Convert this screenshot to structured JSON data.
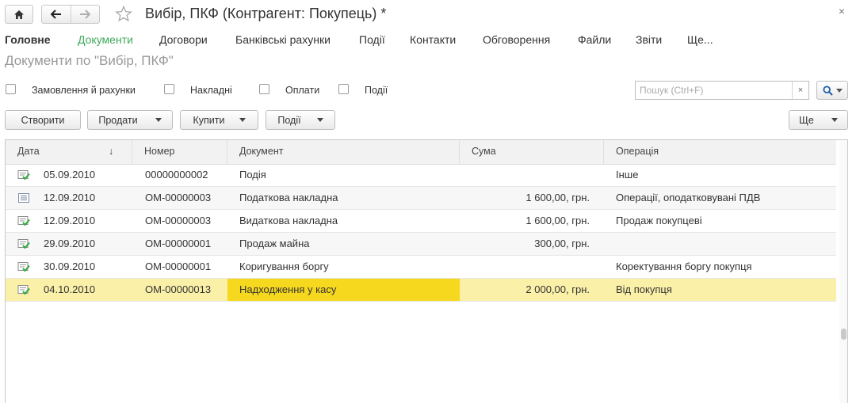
{
  "window": {
    "title": "Вибір, ПКФ (Контрагент: Покупець) *",
    "close_label": "×",
    "subtitle": "Документи по \"Вибір, ПКФ\""
  },
  "tabs": [
    {
      "label": "Головне",
      "state": "bold"
    },
    {
      "label": "Документи",
      "state": "active"
    },
    {
      "label": "Договори",
      "state": "normal"
    },
    {
      "label": "Банківські рахунки",
      "state": "normal"
    },
    {
      "label": "Події",
      "state": "normal"
    },
    {
      "label": "Контакти",
      "state": "normal"
    },
    {
      "label": "Обговорення",
      "state": "normal"
    },
    {
      "label": "Файли",
      "state": "normal"
    },
    {
      "label": "Звіти",
      "state": "normal"
    },
    {
      "label": "Ще...",
      "state": "normal"
    }
  ],
  "filters": [
    {
      "label": "Замовлення й рахунки",
      "checked": false
    },
    {
      "label": "Накладні",
      "checked": false
    },
    {
      "label": "Оплати",
      "checked": false
    },
    {
      "label": "Події",
      "checked": false
    }
  ],
  "search": {
    "placeholder": "Пошук (Ctrl+F)",
    "value": "",
    "clear_label": "×"
  },
  "commands": {
    "create": "Створити",
    "sell": "Продати",
    "buy": "Купити",
    "events": "Події",
    "more": "Ще"
  },
  "table": {
    "columns": [
      "Дата",
      "Номер",
      "Документ",
      "Сума",
      "Операція"
    ],
    "sort_indicator": "↓",
    "rows": [
      {
        "icon": "document-posted-icon",
        "date": "05.09.2010",
        "number": "00000000002",
        "document": "Подія",
        "sum": "",
        "operation": "Інше"
      },
      {
        "icon": "document-list-icon",
        "date": "12.09.2010",
        "number": "ОМ-00000003",
        "document": "Податкова накладна",
        "sum": "1 600,00, грн.",
        "operation": "Операції, оподатковувані ПДВ"
      },
      {
        "icon": "document-posted-icon",
        "date": "12.09.2010",
        "number": "ОМ-00000003",
        "document": "Видаткова накладна",
        "sum": "1 600,00, грн.",
        "operation": "Продаж покупцеві"
      },
      {
        "icon": "document-posted-icon",
        "date": "29.09.2010",
        "number": "ОМ-00000001",
        "document": "Продаж майна",
        "sum": "300,00, грн.",
        "operation": ""
      },
      {
        "icon": "document-posted-icon",
        "date": "30.09.2010",
        "number": "ОМ-00000001",
        "document": "Коригування боргу",
        "sum": "",
        "operation": "Коректування боргу покупця"
      },
      {
        "icon": "document-posted-icon",
        "date": "04.10.2010",
        "number": "ОМ-00000013",
        "document": "Надходження у касу",
        "sum": "2 000,00, грн.",
        "operation": "Від покупця",
        "selected": true
      }
    ]
  },
  "colors": {
    "accent_tab": "#3eaa5b",
    "selected_row": "#fbf0a8",
    "focused_cell": "#f6d81e",
    "posted_check": "#2eaa3e"
  }
}
